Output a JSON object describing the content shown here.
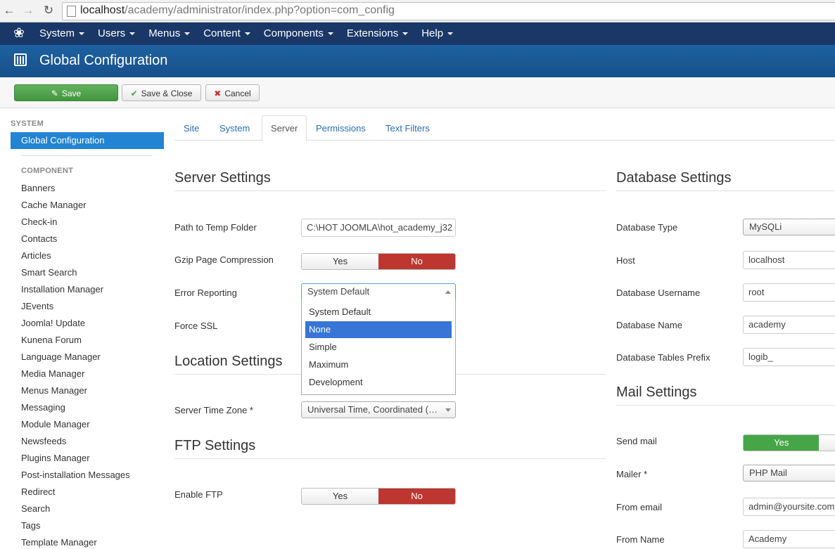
{
  "browser": {
    "url_host": "localhost",
    "url_path": "/academy/administrator/index.php?option=com_config"
  },
  "topnav": {
    "items": [
      "System",
      "Users",
      "Menus",
      "Content",
      "Components",
      "Extensions",
      "Help"
    ]
  },
  "header": {
    "title": "Global Configuration"
  },
  "toolbar": {
    "save": "Save",
    "save_close": "Save & Close",
    "cancel": "Cancel"
  },
  "sidebar": {
    "system_heading": "SYSTEM",
    "active_item": "Global Configuration",
    "component_heading": "COMPONENT",
    "items": [
      "Banners",
      "Cache Manager",
      "Check-in",
      "Contacts",
      "Articles",
      "Smart Search",
      "Installation Manager",
      "JEvents",
      "Joomla! Update",
      "Kunena Forum",
      "Language Manager",
      "Media Manager",
      "Menus Manager",
      "Messaging",
      "Module Manager",
      "Newsfeeds",
      "Plugins Manager",
      "Post-installation Messages",
      "Redirect",
      "Search",
      "Tags",
      "Template Manager"
    ]
  },
  "tabs": [
    "Site",
    "System",
    "Server",
    "Permissions",
    "Text Filters"
  ],
  "server": {
    "title": "Server Settings",
    "temp_label": "Path to Temp Folder",
    "temp_value": "C:\\HOT JOOMLA\\hot_academy_j32",
    "gzip_label": "Gzip Page Compression",
    "error_label": "Error Reporting",
    "error_value": "System Default",
    "ssl_label": "Force SSL",
    "error_options": [
      "System Default",
      "None",
      "Simple",
      "Maximum",
      "Development"
    ],
    "highlighted_option": "None"
  },
  "location": {
    "title": "Location Settings",
    "tz_label": "Server Time Zone *",
    "tz_value": "Universal Time, Coordinated (…"
  },
  "ftp": {
    "title": "FTP Settings",
    "enable_label": "Enable FTP"
  },
  "toggle": {
    "yes": "Yes",
    "no": "No"
  },
  "database": {
    "title": "Database Settings",
    "type_label": "Database Type",
    "type_value": "MySQLi",
    "host_label": "Host",
    "host_value": "localhost",
    "user_label": "Database Username",
    "user_value": "root",
    "name_label": "Database Name",
    "name_value": "academy",
    "prefix_label": "Database Tables Prefix",
    "prefix_value": "logib_"
  },
  "mail": {
    "title": "Mail Settings",
    "send_label": "Send mail",
    "mailer_label": "Mailer *",
    "mailer_value": "PHP Mail",
    "from_email_label": "From email",
    "from_email_value": "admin@yoursite.com",
    "from_name_label": "From Name",
    "from_name_value": "Academy"
  }
}
